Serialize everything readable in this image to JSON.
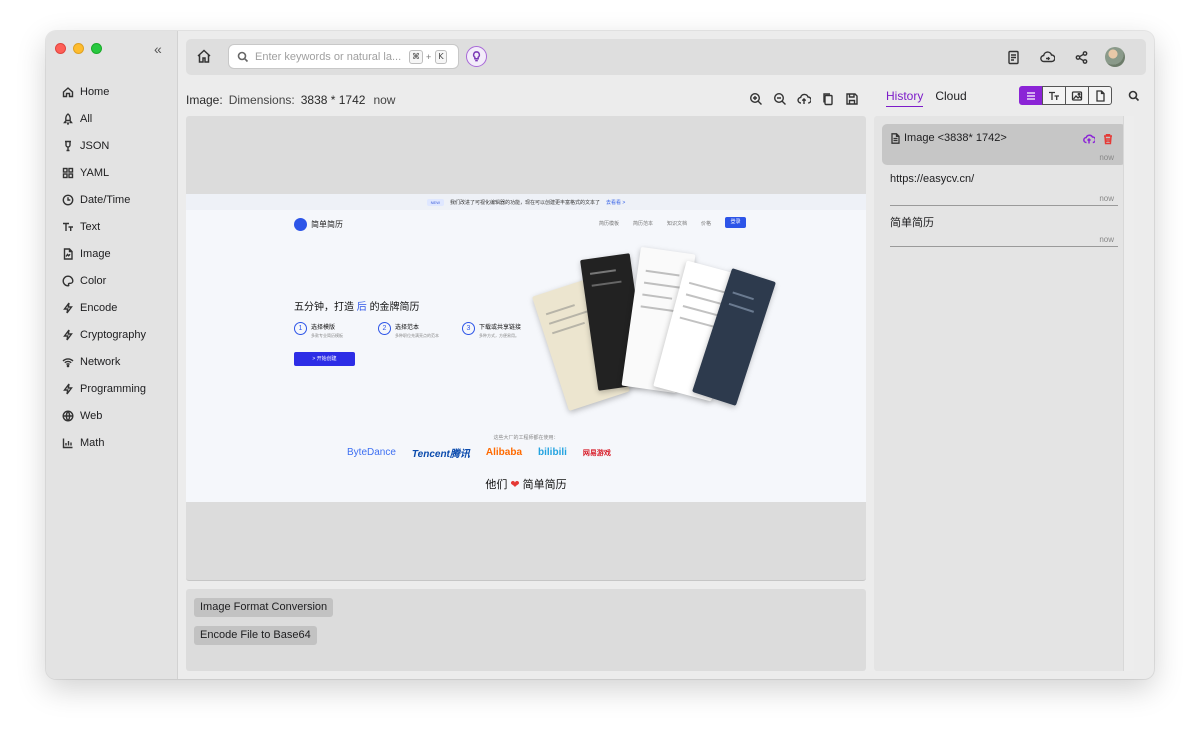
{
  "sidebar": {
    "items": [
      {
        "label": "Home",
        "icon": "home-icon"
      },
      {
        "label": "All",
        "icon": "rocket-icon"
      },
      {
        "label": "JSON",
        "icon": "braces-icon"
      },
      {
        "label": "YAML",
        "icon": "grid-icon"
      },
      {
        "label": "Date/Time",
        "icon": "clock-icon"
      },
      {
        "label": "Text",
        "icon": "text-icon"
      },
      {
        "label": "Image",
        "icon": "image-file-icon"
      },
      {
        "label": "Color",
        "icon": "palette-icon"
      },
      {
        "label": "Encode",
        "icon": "bolt-icon"
      },
      {
        "label": "Cryptography",
        "icon": "bolt-icon"
      },
      {
        "label": "Network",
        "icon": "wifi-icon"
      },
      {
        "label": "Programming",
        "icon": "bolt-icon"
      },
      {
        "label": "Web",
        "icon": "globe-icon"
      },
      {
        "label": "Math",
        "icon": "chart-icon"
      }
    ]
  },
  "toolbar": {
    "search_placeholder": "Enter keywords or natural la...",
    "shortcut_cmd": "⌘",
    "shortcut_plus": "+",
    "shortcut_key": "K"
  },
  "info": {
    "label": "Image:",
    "dimensions_label": "Dimensions:",
    "dimensions_value": "3838 * 1742",
    "time": "now"
  },
  "preview": {
    "banner_new": "NEW",
    "banner_text": "我们改进了可视化编辑器的功能，现在可以创建更丰富格式的文本了",
    "banner_link": "去看看 >",
    "logo_text": "简单简历",
    "nav_links": [
      "简历模板",
      "简历范本",
      "知识文档",
      "价格"
    ],
    "login": "登录",
    "headline_pre": "五分钟，打造",
    "headline_accent": "后",
    "headline_post": "的金牌简历",
    "steps": [
      {
        "num": "1",
        "title": "选择模版",
        "desc": "多款专业简历模板"
      },
      {
        "num": "2",
        "title": "选择范本",
        "desc": "多种职位充满亮点的范本"
      },
      {
        "num": "3",
        "title": "下载或共享链接",
        "desc": "多种方式，方便易用。"
      }
    ],
    "cta": "> 开始创建",
    "brands_caption": "这些大厂的工程师都在使用：",
    "brands": [
      "ByteDance",
      "Tencent腾讯",
      "Alibaba",
      "bilibili",
      "网易游戏"
    ],
    "loved_pre": "他们",
    "loved_heart": "❤",
    "loved_post": "简单简历"
  },
  "actions": [
    {
      "label": "Image Format Conversion"
    },
    {
      "label": "Encode File to Base64"
    }
  ],
  "right": {
    "tabs": [
      {
        "label": "History",
        "active": true
      },
      {
        "label": "Cloud",
        "active": false
      }
    ],
    "history": [
      {
        "text": "Image <3838* 1742>",
        "time": "now",
        "selected": true
      },
      {
        "text": "https://easycv.cn/",
        "time": "now",
        "selected": false
      },
      {
        "text": "简单简历",
        "time": "now",
        "selected": false
      }
    ]
  },
  "colors": {
    "accent": "#7d1cc9",
    "traffic_red": "#fe5f57",
    "traffic_yellow": "#febc2e",
    "traffic_green": "#28c840",
    "delete_red": "#e53935"
  }
}
